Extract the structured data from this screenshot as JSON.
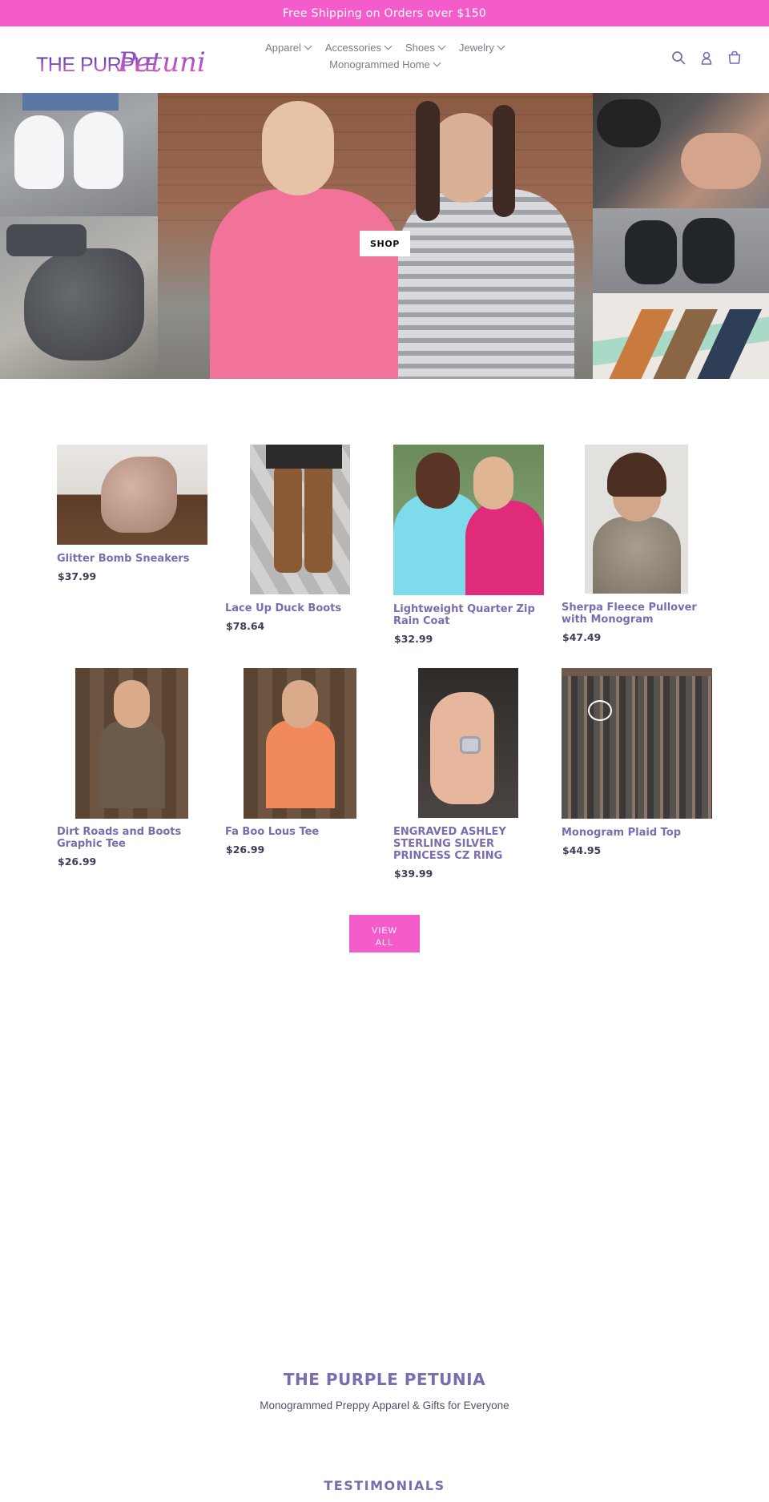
{
  "announcement": "Free Shipping on Orders over $150",
  "brand": {
    "logo_text_part1": "THE PURPLE",
    "logo_text_part2": "Petunia",
    "name": "THE PURPLE PETUNIA",
    "tagline": "Monogrammed Preppy Apparel & Gifts for Everyone"
  },
  "nav": {
    "row1": [
      {
        "label": "Apparel"
      },
      {
        "label": "Accessories"
      },
      {
        "label": "Shoes"
      },
      {
        "label": "Jewelry"
      }
    ],
    "row2": [
      {
        "label": "Monogrammed Home"
      }
    ]
  },
  "header_icons": [
    "search-icon",
    "account-icon",
    "cart-icon"
  ],
  "hero": {
    "button_label": "SHOP"
  },
  "products": [
    {
      "title": "Glitter Bomb Sneakers",
      "price": "$37.99"
    },
    {
      "title": "Lace Up Duck Boots",
      "price": "$78.64"
    },
    {
      "title": "Lightweight Quarter Zip Rain Coat",
      "price": "$32.99"
    },
    {
      "title": "Sherpa Fleece Pullover with Monogram",
      "price": "$47.49"
    },
    {
      "title": "Dirt Roads and Boots Graphic Tee",
      "price": "$26.99"
    },
    {
      "title": "Fa Boo Lous Tee",
      "price": "$26.99"
    },
    {
      "title": "ENGRAVED ASHLEY STERLING SILVER PRINCESS CZ RING",
      "price": "$39.99"
    },
    {
      "title": "Monogram Plaid Top",
      "price": "$44.95"
    }
  ],
  "view_all": {
    "line1": "VIEW",
    "line2": "ALL"
  },
  "testimonials_heading": "TESTIMONIALS",
  "colors": {
    "accent_pink": "#f45ccb",
    "brand_purple": "#7a6cae",
    "price_navy": "#3d3f5a"
  }
}
